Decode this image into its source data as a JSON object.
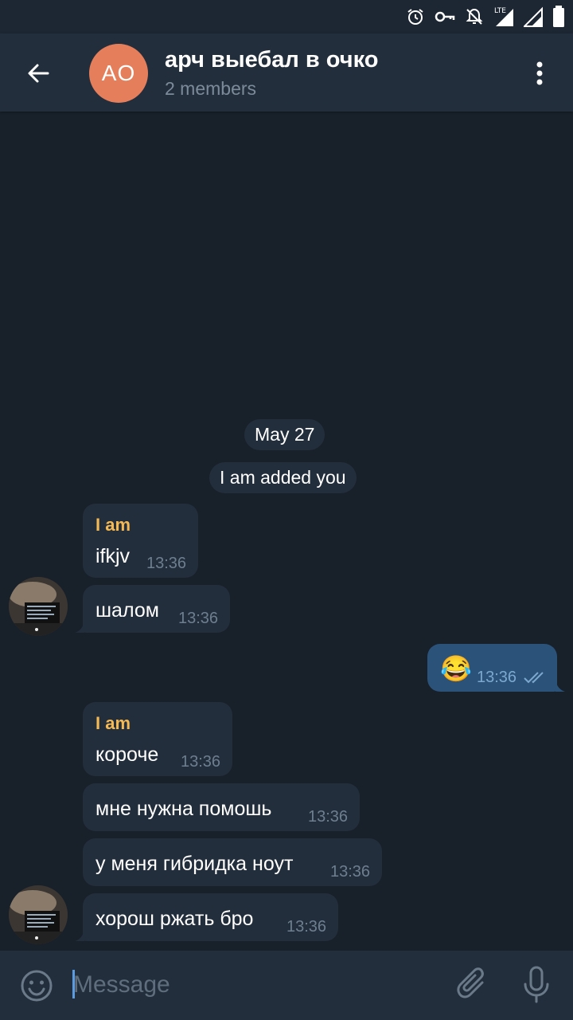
{
  "status_bar": {
    "lte_label": "LTE",
    "icons": [
      "alarm-icon",
      "vpn-key-icon",
      "notifications-off-icon",
      "signal-lte-icon",
      "signal-icon",
      "battery-icon"
    ]
  },
  "header": {
    "avatar_initials": "AO",
    "avatar_color": "#e57f5b",
    "title": "арч выебал в очко",
    "subtitle": "2 members"
  },
  "service_messages": {
    "date": "May 27",
    "added": "I am added you"
  },
  "messages": [
    {
      "sender": "I am",
      "text": "ifkjv",
      "time": "13:36",
      "direction": "in"
    },
    {
      "sender": "",
      "text": "шалом",
      "time": "13:36",
      "direction": "in"
    },
    {
      "sender": "",
      "text": "😂",
      "time": "13:36",
      "direction": "out",
      "status": "read"
    },
    {
      "sender": "I am",
      "text": "короче",
      "time": "13:36",
      "direction": "in"
    },
    {
      "sender": "",
      "text": "мне нужна помошь",
      "time": "13:36",
      "direction": "in"
    },
    {
      "sender": "",
      "text": "у меня гибридка ноут",
      "time": "13:36",
      "direction": "in"
    },
    {
      "sender": "",
      "text": "хорош ржать бро",
      "time": "13:36",
      "direction": "in"
    }
  ],
  "input": {
    "placeholder": "Message",
    "value": ""
  },
  "colors": {
    "background": "#18202a",
    "header": "#232e3c",
    "incoming_bubble": "#232e3c",
    "outgoing_bubble": "#2b5278",
    "sender_name": "#f5b953",
    "accent": "#5b9be0"
  }
}
